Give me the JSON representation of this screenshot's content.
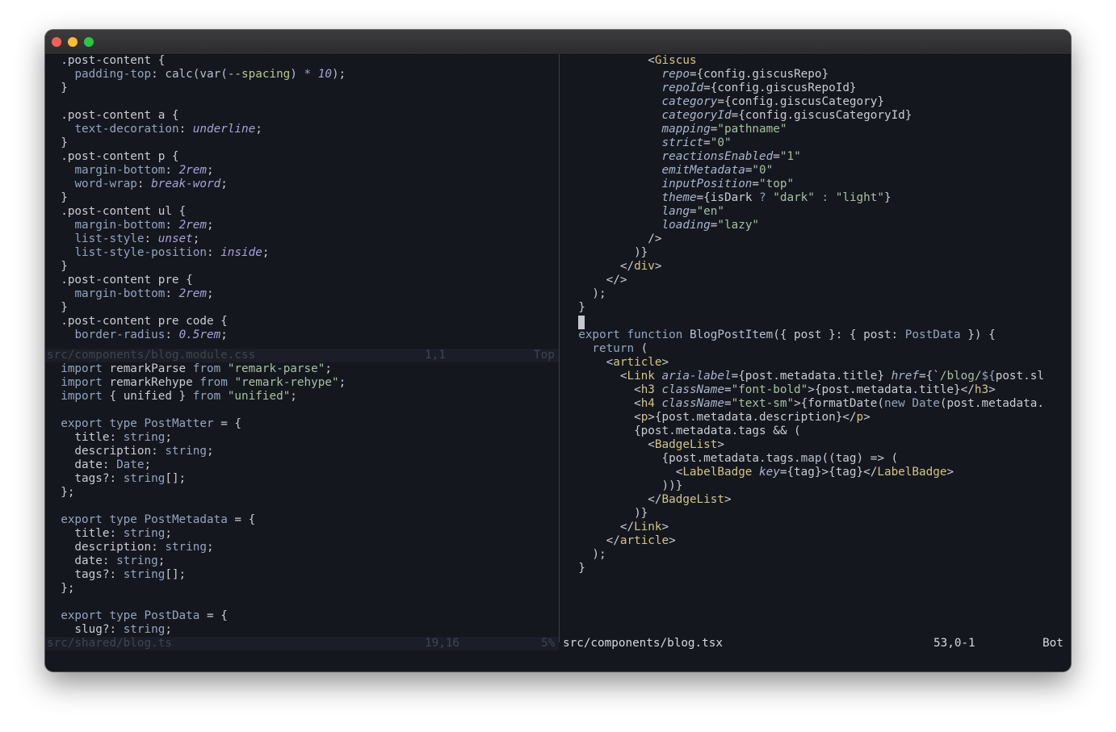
{
  "colors": {
    "background": "#15171e",
    "selector": "#c9ccd5",
    "property": "#93a4bf",
    "value": "#a9a2d8",
    "string": "#a6c1a0",
    "keyword": "#93a4bf",
    "type": "#93a4bf",
    "jsx_tag": "#d2c486",
    "jsx_attr": "#a8b6cf",
    "var": "#b7c796"
  },
  "window": {
    "buttons": {
      "close": "close-icon",
      "minimize": "minimize-icon",
      "maximize": "maximize-icon"
    }
  },
  "panes": {
    "css": {
      "lines": [
        [
          [
            "sel",
            "  .post-content {"
          ]
        ],
        [
          [
            "pun",
            "    "
          ],
          [
            "prop",
            "padding-top"
          ],
          [
            "pun",
            ": "
          ],
          [
            "fn",
            "calc(var("
          ],
          [
            "var",
            "--spacing"
          ],
          [
            "fn",
            ")"
          ],
          [
            "pun",
            " "
          ],
          [
            "op",
            "*"
          ],
          [
            "pun",
            " "
          ],
          [
            "num",
            "10"
          ],
          [
            "fn",
            ")"
          ],
          [
            "pun",
            ";"
          ]
        ],
        [
          [
            "sel",
            "  }"
          ]
        ],
        [],
        [
          [
            "sel",
            "  .post-content a {"
          ]
        ],
        [
          [
            "pun",
            "    "
          ],
          [
            "prop",
            "text-decoration"
          ],
          [
            "pun",
            ": "
          ],
          [
            "val",
            "underline"
          ],
          [
            "pun",
            ";"
          ]
        ],
        [
          [
            "sel",
            "  }"
          ]
        ],
        [
          [
            "sel",
            "  .post-content p {"
          ]
        ],
        [
          [
            "pun",
            "    "
          ],
          [
            "prop",
            "margin-bottom"
          ],
          [
            "pun",
            ": "
          ],
          [
            "num",
            "2rem"
          ],
          [
            "pun",
            ";"
          ]
        ],
        [
          [
            "pun",
            "    "
          ],
          [
            "prop",
            "word-wrap"
          ],
          [
            "pun",
            ": "
          ],
          [
            "val",
            "break-word"
          ],
          [
            "pun",
            ";"
          ]
        ],
        [
          [
            "sel",
            "  }"
          ]
        ],
        [
          [
            "sel",
            "  .post-content ul {"
          ]
        ],
        [
          [
            "pun",
            "    "
          ],
          [
            "prop",
            "margin-bottom"
          ],
          [
            "pun",
            ": "
          ],
          [
            "num",
            "2rem"
          ],
          [
            "pun",
            ";"
          ]
        ],
        [
          [
            "pun",
            "    "
          ],
          [
            "prop",
            "list-style"
          ],
          [
            "pun",
            ": "
          ],
          [
            "val",
            "unset"
          ],
          [
            "pun",
            ";"
          ]
        ],
        [
          [
            "pun",
            "    "
          ],
          [
            "prop",
            "list-style-position"
          ],
          [
            "pun",
            ": "
          ],
          [
            "val",
            "inside"
          ],
          [
            "pun",
            ";"
          ]
        ],
        [
          [
            "sel",
            "  }"
          ]
        ],
        [
          [
            "sel",
            "  .post-content pre {"
          ]
        ],
        [
          [
            "pun",
            "    "
          ],
          [
            "prop",
            "margin-bottom"
          ],
          [
            "pun",
            ": "
          ],
          [
            "num",
            "2rem"
          ],
          [
            "pun",
            ";"
          ]
        ],
        [
          [
            "sel",
            "  }"
          ]
        ],
        [
          [
            "sel",
            "  .post-content pre code {"
          ]
        ],
        [
          [
            "pun",
            "    "
          ],
          [
            "prop",
            "border-radius"
          ],
          [
            "pun",
            ": "
          ],
          [
            "num",
            "0.5rem"
          ],
          [
            "pun",
            ";"
          ]
        ]
      ],
      "status": {
        "file": "src/components/blog.module.css",
        "position": "1,1",
        "percent": "Top"
      }
    },
    "ts": {
      "lines": [
        [
          [
            "kw",
            "  import"
          ],
          [
            "ident",
            " remarkParse "
          ],
          [
            "kw",
            "from"
          ],
          [
            "pun",
            " "
          ],
          [
            "str",
            "\"remark-parse\""
          ],
          [
            "pun",
            ";"
          ]
        ],
        [
          [
            "kw",
            "  import"
          ],
          [
            "ident",
            " remarkRehype "
          ],
          [
            "kw",
            "from"
          ],
          [
            "pun",
            " "
          ],
          [
            "str",
            "\"remark-rehype\""
          ],
          [
            "pun",
            ";"
          ]
        ],
        [
          [
            "kw",
            "  import"
          ],
          [
            "ident",
            " { unified } "
          ],
          [
            "kw",
            "from"
          ],
          [
            "pun",
            " "
          ],
          [
            "str",
            "\"unified\""
          ],
          [
            "pun",
            ";"
          ]
        ],
        [],
        [
          [
            "kw",
            "  export type"
          ],
          [
            "pun",
            " "
          ],
          [
            "type",
            "PostMatter"
          ],
          [
            "pun",
            " = {"
          ]
        ],
        [
          [
            "ident",
            "    title: "
          ],
          [
            "type",
            "string"
          ],
          [
            "pun",
            ";"
          ]
        ],
        [
          [
            "ident",
            "    description: "
          ],
          [
            "type",
            "string"
          ],
          [
            "pun",
            ";"
          ]
        ],
        [
          [
            "ident",
            "    date: "
          ],
          [
            "type",
            "Date"
          ],
          [
            "pun",
            ";"
          ]
        ],
        [
          [
            "ident",
            "    tags?: "
          ],
          [
            "type",
            "string"
          ],
          [
            "pun",
            "[];"
          ]
        ],
        [
          [
            "pun",
            "  };"
          ]
        ],
        [],
        [
          [
            "kw",
            "  export type"
          ],
          [
            "pun",
            " "
          ],
          [
            "type",
            "PostMetadata"
          ],
          [
            "pun",
            " = {"
          ]
        ],
        [
          [
            "ident",
            "    title: "
          ],
          [
            "type",
            "string"
          ],
          [
            "pun",
            ";"
          ]
        ],
        [
          [
            "ident",
            "    description: "
          ],
          [
            "type",
            "string"
          ],
          [
            "pun",
            ";"
          ]
        ],
        [
          [
            "ident",
            "    date: "
          ],
          [
            "type",
            "string"
          ],
          [
            "pun",
            ";"
          ]
        ],
        [
          [
            "ident",
            "    tags?: "
          ],
          [
            "type",
            "string"
          ],
          [
            "pun",
            "[];"
          ]
        ],
        [
          [
            "pun",
            "  };"
          ]
        ],
        [],
        [
          [
            "kw",
            "  export type"
          ],
          [
            "pun",
            " "
          ],
          [
            "type",
            "PostData"
          ],
          [
            "pun",
            " = {"
          ]
        ],
        [
          [
            "ident",
            "    slug?: "
          ],
          [
            "type",
            "string"
          ],
          [
            "pun",
            ";"
          ]
        ]
      ],
      "status": {
        "file": "src/shared/blog.ts",
        "position": "19,16",
        "percent": "5%"
      }
    },
    "tsx": {
      "lines": [
        [
          [
            "pun",
            "            <"
          ],
          [
            "tag",
            "Giscus"
          ]
        ],
        [
          [
            "pun",
            "              "
          ],
          [
            "attr",
            "repo"
          ],
          [
            "pun",
            "={config.giscusRepo}"
          ]
        ],
        [
          [
            "pun",
            "              "
          ],
          [
            "attr",
            "repoId"
          ],
          [
            "pun",
            "={config.giscusRepoId}"
          ]
        ],
        [
          [
            "pun",
            "              "
          ],
          [
            "attr",
            "category"
          ],
          [
            "pun",
            "={config.giscusCategory}"
          ]
        ],
        [
          [
            "pun",
            "              "
          ],
          [
            "attr",
            "categoryId"
          ],
          [
            "pun",
            "={config.giscusCategoryId}"
          ]
        ],
        [
          [
            "pun",
            "              "
          ],
          [
            "attr",
            "mapping"
          ],
          [
            "pun",
            "="
          ],
          [
            "str",
            "\"pathname\""
          ]
        ],
        [
          [
            "pun",
            "              "
          ],
          [
            "attr",
            "strict"
          ],
          [
            "pun",
            "="
          ],
          [
            "str",
            "\"0\""
          ]
        ],
        [
          [
            "pun",
            "              "
          ],
          [
            "attr",
            "reactionsEnabled"
          ],
          [
            "pun",
            "="
          ],
          [
            "str",
            "\"1\""
          ]
        ],
        [
          [
            "pun",
            "              "
          ],
          [
            "attr",
            "emitMetadata"
          ],
          [
            "pun",
            "="
          ],
          [
            "str",
            "\"0\""
          ]
        ],
        [
          [
            "pun",
            "              "
          ],
          [
            "attr",
            "inputPosition"
          ],
          [
            "pun",
            "="
          ],
          [
            "str",
            "\"top\""
          ]
        ],
        [
          [
            "pun",
            "              "
          ],
          [
            "attr",
            "theme"
          ],
          [
            "pun",
            "={isDark "
          ],
          [
            "op",
            "?"
          ],
          [
            "pun",
            " "
          ],
          [
            "str",
            "\"dark\""
          ],
          [
            "pun",
            " "
          ],
          [
            "op",
            ":"
          ],
          [
            "pun",
            " "
          ],
          [
            "str",
            "\"light\""
          ],
          [
            "pun",
            "}"
          ]
        ],
        [
          [
            "pun",
            "              "
          ],
          [
            "attr",
            "lang"
          ],
          [
            "pun",
            "="
          ],
          [
            "str",
            "\"en\""
          ]
        ],
        [
          [
            "pun",
            "              "
          ],
          [
            "attr",
            "loading"
          ],
          [
            "pun",
            "="
          ],
          [
            "str",
            "\"lazy\""
          ]
        ],
        [
          [
            "pun",
            "            />"
          ]
        ],
        [
          [
            "pun",
            "          )}"
          ]
        ],
        [
          [
            "pun",
            "        </"
          ],
          [
            "tag",
            "div"
          ],
          [
            "pun",
            ">"
          ]
        ],
        [
          [
            "pun",
            "      </>"
          ]
        ],
        [
          [
            "pun",
            "    );"
          ]
        ],
        [
          [
            "pun",
            "  }"
          ]
        ],
        [],
        [
          [
            "kw",
            "  export function"
          ],
          [
            "pun",
            " "
          ],
          [
            "fn",
            "BlogPostItem"
          ],
          [
            "pun",
            "({ post }: { post: "
          ],
          [
            "type",
            "PostData"
          ],
          [
            "pun",
            " }) {"
          ]
        ],
        [
          [
            "kw",
            "    return"
          ],
          [
            "pun",
            " ("
          ]
        ],
        [
          [
            "pun",
            "      <"
          ],
          [
            "tag",
            "article"
          ],
          [
            "pun",
            ">"
          ]
        ],
        [
          [
            "pun",
            "        <"
          ],
          [
            "tag",
            "Link"
          ],
          [
            "pun",
            " "
          ],
          [
            "attr",
            "aria-label"
          ],
          [
            "pun",
            "={post.metadata.title} "
          ],
          [
            "attr",
            "href"
          ],
          [
            "pun",
            "={`"
          ],
          [
            "str",
            "/blog/"
          ],
          [
            "op",
            "${"
          ],
          [
            "pun",
            "post.sl"
          ]
        ],
        [
          [
            "pun",
            "          <"
          ],
          [
            "tag",
            "h3"
          ],
          [
            "pun",
            " "
          ],
          [
            "attr",
            "className"
          ],
          [
            "pun",
            "="
          ],
          [
            "str",
            "\"font-bold\""
          ],
          [
            "pun",
            ">{post.metadata.title}</"
          ],
          [
            "tag",
            "h3"
          ],
          [
            "pun",
            ">"
          ]
        ],
        [
          [
            "pun",
            "          <"
          ],
          [
            "tag",
            "h4"
          ],
          [
            "pun",
            " "
          ],
          [
            "attr",
            "className"
          ],
          [
            "pun",
            "="
          ],
          [
            "str",
            "\"text-sm\""
          ],
          [
            "pun",
            ">{formatDate("
          ],
          [
            "kw",
            "new"
          ],
          [
            "pun",
            " "
          ],
          [
            "type",
            "Date"
          ],
          [
            "pun",
            "(post.metadata."
          ]
        ],
        [
          [
            "pun",
            "          <"
          ],
          [
            "tag",
            "p"
          ],
          [
            "pun",
            ">{post.metadata.description}</"
          ],
          [
            "tag",
            "p"
          ],
          [
            "pun",
            ">"
          ]
        ],
        [
          [
            "pun",
            "          {post.metadata.tags && ("
          ]
        ],
        [
          [
            "pun",
            "            <"
          ],
          [
            "tag",
            "BadgeList"
          ],
          [
            "pun",
            ">"
          ]
        ],
        [
          [
            "pun",
            "              {post.metadata.tags."
          ],
          [
            "fn",
            "map"
          ],
          [
            "pun",
            "((tag) => ("
          ]
        ],
        [
          [
            "pun",
            "                <"
          ],
          [
            "tag",
            "LabelBadge"
          ],
          [
            "pun",
            " "
          ],
          [
            "attr",
            "key"
          ],
          [
            "pun",
            "={tag}>{tag}</"
          ],
          [
            "tag",
            "LabelBadge"
          ],
          [
            "pun",
            ">"
          ]
        ],
        [
          [
            "pun",
            "              ))}"
          ]
        ],
        [
          [
            "pun",
            "            </"
          ],
          [
            "tag",
            "BadgeList"
          ],
          [
            "pun",
            ">"
          ]
        ],
        [
          [
            "pun",
            "          )}"
          ]
        ],
        [
          [
            "pun",
            "        </"
          ],
          [
            "tag",
            "Link"
          ],
          [
            "pun",
            ">"
          ]
        ],
        [
          [
            "pun",
            "      </"
          ],
          [
            "tag",
            "article"
          ],
          [
            "pun",
            ">"
          ]
        ],
        [
          [
            "pun",
            "    );"
          ]
        ],
        [
          [
            "pun",
            "  }"
          ]
        ]
      ],
      "status": {
        "file": "src/components/blog.tsx",
        "position": "53,0-1",
        "percent": "Bot"
      }
    }
  }
}
